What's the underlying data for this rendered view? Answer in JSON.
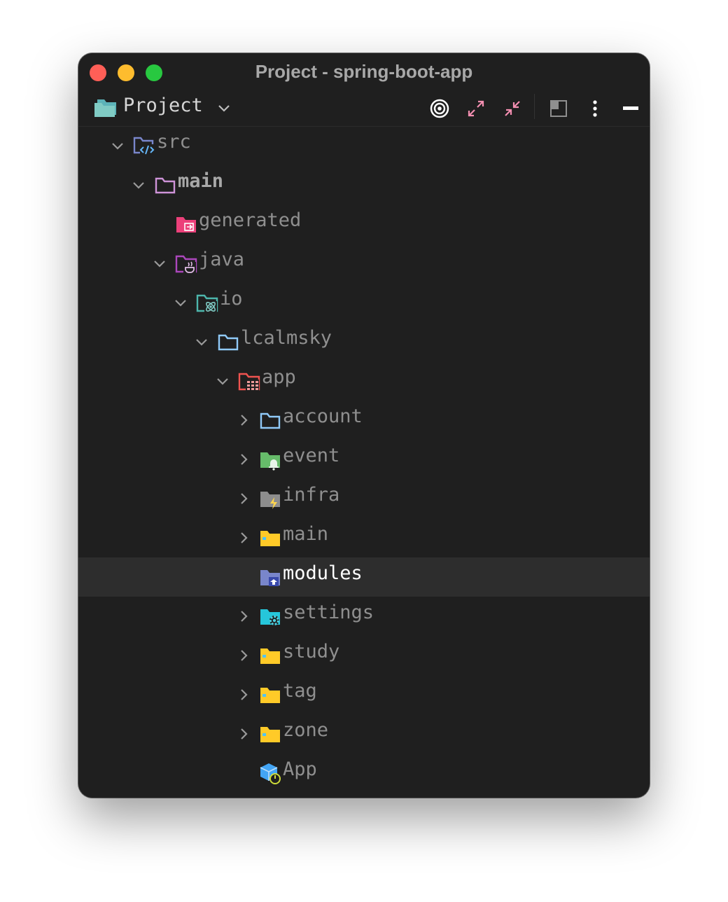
{
  "window": {
    "title": "Project - spring-boot-app"
  },
  "toolbar": {
    "view_label": "Project",
    "icons": [
      "target-icon",
      "expand-icon",
      "collapse-icon",
      "layout-icon",
      "more-icon",
      "minimize-icon"
    ]
  },
  "tree": [
    {
      "label": "src",
      "depth": 0,
      "expanded": true,
      "icon": "source-folder-icon"
    },
    {
      "label": "main",
      "depth": 1,
      "expanded": true,
      "icon": "folder-icon",
      "bold": true
    },
    {
      "label": "generated",
      "depth": 2,
      "expanded": null,
      "icon": "generated-folder-icon"
    },
    {
      "label": "java",
      "depth": 2,
      "expanded": true,
      "icon": "java-folder-icon"
    },
    {
      "label": "io",
      "depth": 3,
      "expanded": true,
      "icon": "atom-folder-icon"
    },
    {
      "label": "lcalmsky",
      "depth": 4,
      "expanded": true,
      "icon": "folder-icon"
    },
    {
      "label": "app",
      "depth": 5,
      "expanded": true,
      "icon": "app-folder-icon"
    },
    {
      "label": "account",
      "depth": 6,
      "expanded": false,
      "icon": "folder-icon"
    },
    {
      "label": "event",
      "depth": 6,
      "expanded": false,
      "icon": "event-folder-icon"
    },
    {
      "label": "infra",
      "depth": 6,
      "expanded": false,
      "icon": "infra-folder-icon"
    },
    {
      "label": "main",
      "depth": 6,
      "expanded": false,
      "icon": "package-folder-icon"
    },
    {
      "label": "modules",
      "depth": 6,
      "expanded": null,
      "icon": "modules-folder-icon",
      "selected": true
    },
    {
      "label": "settings",
      "depth": 6,
      "expanded": false,
      "icon": "settings-folder-icon"
    },
    {
      "label": "study",
      "depth": 6,
      "expanded": false,
      "icon": "package-folder-icon"
    },
    {
      "label": "tag",
      "depth": 6,
      "expanded": false,
      "icon": "package-folder-icon"
    },
    {
      "label": "zone",
      "depth": 6,
      "expanded": false,
      "icon": "package-folder-icon"
    },
    {
      "label": "App",
      "depth": 6,
      "expanded": null,
      "icon": "spring-app-icon"
    }
  ],
  "colors": {
    "background": "#1f1f1f",
    "selection": "#2d2d2d",
    "accent_pink": "#f48fb1",
    "text": "#8f8f8f"
  }
}
